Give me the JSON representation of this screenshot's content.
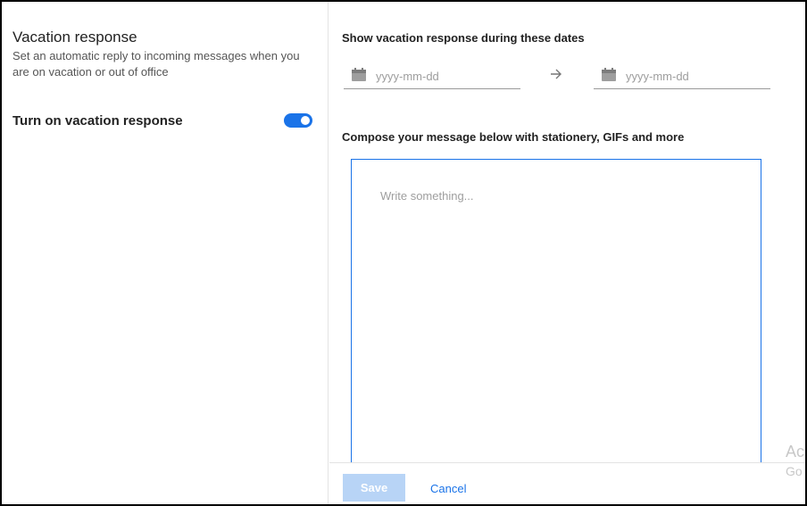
{
  "left_pane": {
    "title": "Vacation response",
    "description": "Set an automatic reply to incoming messages when you are on vacation or out of office",
    "toggle_label": "Turn on vacation response",
    "toggle_on": true
  },
  "right_pane": {
    "dates_label": "Show vacation response during these dates",
    "start_date": {
      "placeholder": "yyyy-mm-dd",
      "icon": "calendar-icon"
    },
    "end_date": {
      "placeholder": "yyyy-mm-dd",
      "icon": "calendar-icon"
    },
    "range_arrow_icon": "arrow-right-icon",
    "compose_label": "Compose your message below with stationery, GIFs and more",
    "editor_placeholder": "Write something..."
  },
  "footer": {
    "save_label": "Save",
    "cancel_label": "Cancel"
  },
  "watermark": {
    "line1": "Ac",
    "line2": "Go"
  },
  "colors": {
    "accent": "#1a73e8",
    "save_disabled": "#b8d4f6"
  }
}
